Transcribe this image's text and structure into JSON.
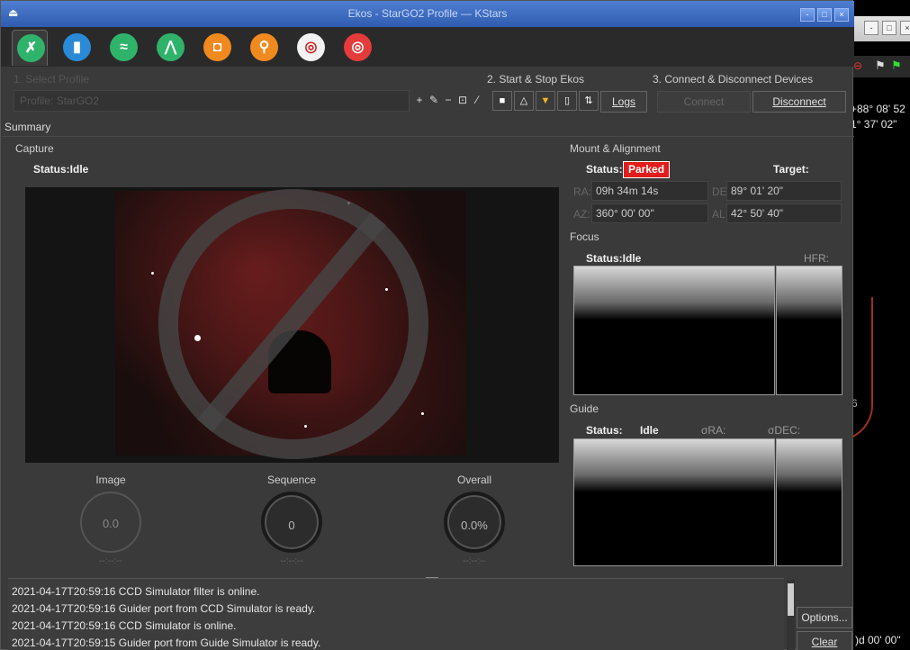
{
  "window": {
    "title": "Ekos - StarGO2 Profile — KStars",
    "controls": [
      "-",
      "□",
      "×"
    ]
  },
  "background_window": {
    "controls": [
      "-",
      "□",
      "×"
    ],
    "coord1": "+88° 08' 52",
    "coord2": "1° 37' 02\"",
    "coord3": "6",
    "bottom_readout": ")d 00' 00\""
  },
  "tabs": [
    {
      "icon": "wrench-icon",
      "color": "#2fb36b",
      "glyph": "✗"
    },
    {
      "icon": "mount-icon",
      "color": "#2a8ad6",
      "glyph": "▮"
    },
    {
      "icon": "analyze-icon",
      "color": "#2fb36b",
      "glyph": "≈"
    },
    {
      "icon": "tripod-icon",
      "color": "#2fb36b",
      "glyph": "⋀"
    },
    {
      "icon": "camera-icon",
      "color": "#f08a1f",
      "glyph": "◘"
    },
    {
      "icon": "focus-icon",
      "color": "#f08a1f",
      "glyph": "⚲"
    },
    {
      "icon": "align-icon",
      "color": "#f2f2f2",
      "glyph": "◎"
    },
    {
      "icon": "guide-icon",
      "color": "#e53b3b",
      "glyph": "◎"
    }
  ],
  "setup": {
    "step1": "1. Select Profile",
    "profile_label": "Profile:",
    "profile_value": "StarGO2",
    "step2": "2. Start & Stop Ekos",
    "logs_label": "Logs",
    "step3": "3. Connect & Disconnect Devices",
    "connect_label": "Connect",
    "disconnect_label": "Disconnect",
    "profile_tools": [
      "+",
      "✎",
      "−",
      "⊡",
      "⁄"
    ],
    "ekos_tools": [
      "■",
      "△",
      "▼",
      "▯",
      "⇅"
    ]
  },
  "summary": {
    "label": "Summary",
    "capture": {
      "label": "Capture",
      "status": "Status:Idle",
      "image_label": "Image",
      "image_value": "0.0",
      "image_eta": "--:--:--",
      "sequence_label": "Sequence",
      "sequence_value": "0",
      "sequence_eta": "--:--:--",
      "overall_label": "Overall",
      "overall_value": "0.0%",
      "overall_eta": "--:--:--"
    },
    "mount": {
      "label": "Mount & Alignment",
      "status_label": "Status:",
      "status_value": "Parked",
      "target_label": "Target:",
      "ra_label": "RA:",
      "ra_value": "09h 34m 14s",
      "de_label": "DE:",
      "de_value": "89° 01' 20\"",
      "az_label": "AZ:",
      "az_value": "360° 00' 00\"",
      "al_label": "AL:",
      "al_value": "42° 50' 40\""
    },
    "focus": {
      "label": "Focus",
      "status": "Status:Idle",
      "hfr_label": "HFR:"
    },
    "guide": {
      "label": "Guide",
      "status_label": "Status:",
      "status_value": "Idle",
      "ra_label": "σRA:",
      "dec_label": "σDEC:"
    }
  },
  "log": {
    "lines": [
      "2021-04-17T20:59:16 CCD Simulator filter is online.",
      "2021-04-17T20:59:16 Guider port from CCD Simulator is ready.",
      "2021-04-17T20:59:16 CCD Simulator is online.",
      "2021-04-17T20:59:15 Guider port from Guide Simulator is ready."
    ],
    "options_label": "Options...",
    "clear_label": "Clear"
  }
}
